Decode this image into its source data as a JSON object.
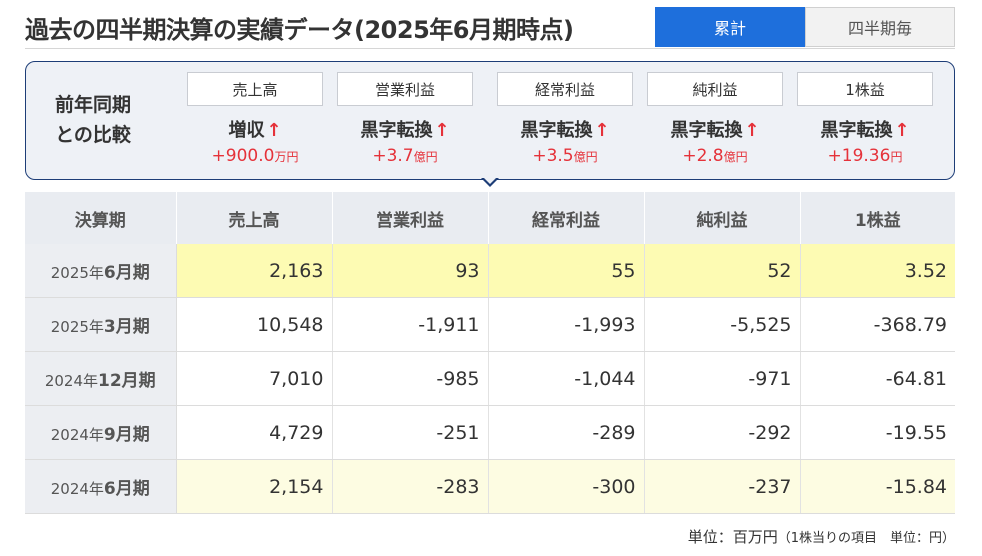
{
  "header": {
    "title": "過去の四半期決算の実績データ(2025年6月期時点)",
    "tabs": [
      {
        "label": "累計",
        "active": true
      },
      {
        "label": "四半期毎",
        "active": false
      }
    ]
  },
  "comparison": {
    "label_line1": "前年同期",
    "label_line2": "との比較",
    "items": [
      {
        "metric": "売上高",
        "change": "増収",
        "value": "+900.0",
        "unit": "万円"
      },
      {
        "metric": "営業利益",
        "change": "黒字転換",
        "value": "+3.7",
        "unit": "億円"
      },
      {
        "metric": "経常利益",
        "change": "黒字転換",
        "value": "+3.5",
        "unit": "億円"
      },
      {
        "metric": "純利益",
        "change": "黒字転換",
        "value": "+2.8",
        "unit": "億円"
      },
      {
        "metric": "1株益",
        "change": "黒字転換",
        "value": "+19.36",
        "unit": "円"
      }
    ],
    "arrow_glyph": "↑"
  },
  "table": {
    "headers": [
      "決算期",
      "売上高",
      "営業利益",
      "経常利益",
      "純利益",
      "1株益"
    ],
    "rows": [
      {
        "year": "2025年",
        "month": "6月期",
        "values": [
          "2,163",
          "93",
          "55",
          "52",
          "3.52"
        ]
      },
      {
        "year": "2025年",
        "month": "3月期",
        "values": [
          "10,548",
          "-1,911",
          "-1,993",
          "-5,525",
          "-368.79"
        ]
      },
      {
        "year": "2024年",
        "month": "12月期",
        "values": [
          "7,010",
          "-985",
          "-1,044",
          "-971",
          "-64.81"
        ]
      },
      {
        "year": "2024年",
        "month": "9月期",
        "values": [
          "4,729",
          "-251",
          "-289",
          "-292",
          "-19.55"
        ]
      },
      {
        "year": "2024年",
        "month": "6月期",
        "values": [
          "2,154",
          "-283",
          "-300",
          "-237",
          "-15.84"
        ]
      }
    ]
  },
  "footer": {
    "unit_main": "単位：百万円",
    "unit_sub": "（1株当りの項目　単位：円）"
  },
  "colors": {
    "accent_blue": "#1e6fdc",
    "panel_border": "#1d3d77",
    "increase_red": "#e5323a",
    "highlight_yellow": "#fdfbb3",
    "highlight_light_yellow": "#fdfce2"
  }
}
